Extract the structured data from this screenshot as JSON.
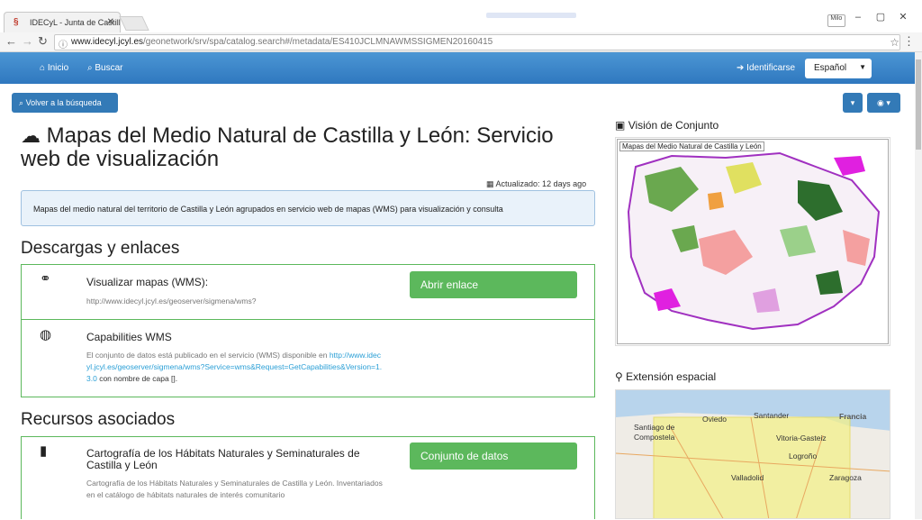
{
  "browser": {
    "tab_title": "IDECyL - Junta de Castilla",
    "url_host": "www.idecyl.jcyl.es",
    "url_path": "/geonetwork/srv/spa/catalog.search#/metadata/ES410JCLMNAWMSSIGMEN20160415",
    "window_badge": "Milo"
  },
  "navbar": {
    "home_label": "Inicio",
    "search_label": "Buscar",
    "login_label": "Identificarse",
    "language_value": "Español"
  },
  "toolbar": {
    "back_label": "Volver a la búsqueda"
  },
  "record": {
    "title": "Mapas del Medio Natural de Castilla y León: Servicio web de visualización",
    "updated": "Actualizado: 12 days ago",
    "abstract": "Mapas del medio natural del territorio de Castilla y León agrupados en servicio web de mapas (WMS) para visualización y consulta"
  },
  "downloads": {
    "heading": "Descargas y enlaces",
    "items": [
      {
        "title": "Visualizar mapas (WMS):",
        "desc": "http://www.idecyl.jcyl.es/geoserver/sigmena/wms?",
        "button": "Abrir enlace"
      },
      {
        "title": "Capabilities WMS",
        "desc_prefix": "El conjunto de datos está publicado en el servicio (WMS) disponible en",
        "desc_link": "http://www.idecyl.jcyl.es/geoserver/sigmena/wms?Service=wms&Request=GetCapabilities&Version=1.3.0",
        "desc_suffix": "con nombre de capa []."
      }
    ]
  },
  "resources": {
    "heading": "Recursos asociados",
    "items": [
      {
        "title": "Cartografía de los Hábitats Naturales y Seminaturales de Castilla y León",
        "desc": "Cartografía de los Hábitats Naturales y Seminaturales de Castilla y León. Inventariados en el catálogo de hábitats naturales de interés comunitario",
        "button": "Conjunto de datos"
      }
    ]
  },
  "sidebar": {
    "overview_heading": "Visión de Conjunto",
    "thumbnail_caption": "Mapas del Medio Natural de Castilla y León",
    "extent_heading": "Extensión espacial",
    "map_labels": [
      "Oviedo",
      "Santander",
      "Francia",
      "Santiago de",
      "Compostela",
      "Vitoria-Gasteiz",
      "Logroño",
      "Valladolid",
      "Zaragoza"
    ]
  },
  "colors": {
    "navbar": "#3a86c8",
    "primary_button": "#337ab7",
    "success": "#5cb85c",
    "link": "#2a9fd6"
  }
}
